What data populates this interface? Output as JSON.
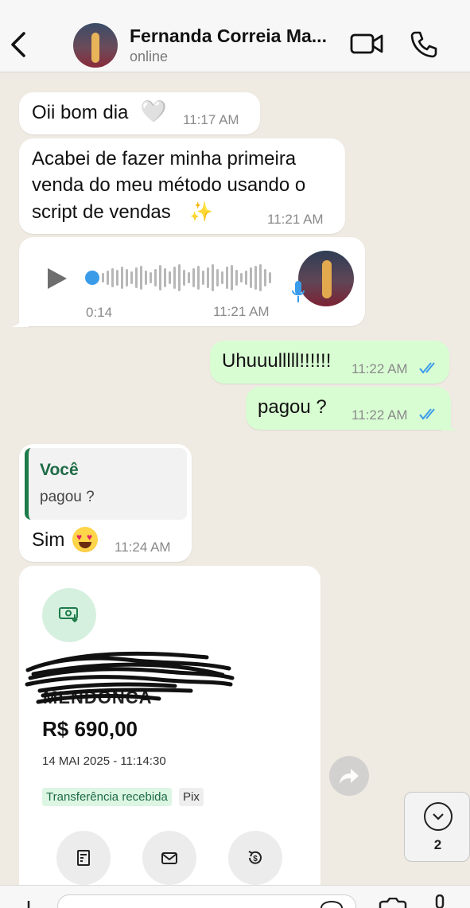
{
  "header": {
    "contact_name": "Fernanda Correia Ma...",
    "status": "online"
  },
  "messages": [
    {
      "direction": "in",
      "text": "Oii bom dia",
      "emoji": "🤍",
      "time": "11:17 AM"
    },
    {
      "direction": "in",
      "lines": [
        "Acabei de fazer minha primeira",
        "venda do meu método usando o",
        "script de vendas"
      ],
      "emoji": "✨",
      "time": "11:21 AM"
    },
    {
      "direction": "in",
      "type": "voice",
      "duration": "0:14",
      "time": "11:21 AM"
    },
    {
      "direction": "out",
      "text": "Uhuuulllll!!!!!!",
      "time": "11:22 AM",
      "status": "read"
    },
    {
      "direction": "out",
      "text": "pagou  ?",
      "time": "11:22 AM",
      "status": "read"
    },
    {
      "direction": "in",
      "quote": {
        "author": "Você",
        "text": "pagou  ?"
      },
      "text": "Sim",
      "time": "11:24 AM"
    }
  ],
  "receipt": {
    "name_visible": "MENDONCA",
    "amount": "R$ 690,00",
    "datetime": "14 MAI 2025 - 11:14:30",
    "tags": [
      "Transferência recebida",
      "Pix"
    ]
  },
  "scroll_down": {
    "unread_count": "2"
  },
  "colors": {
    "background": "#efeae2",
    "outgoing_bubble": "#d9fdd3",
    "incoming_bubble": "#ffffff",
    "read_ticks": "#3a9be9",
    "accent_green": "#1e6b46"
  }
}
